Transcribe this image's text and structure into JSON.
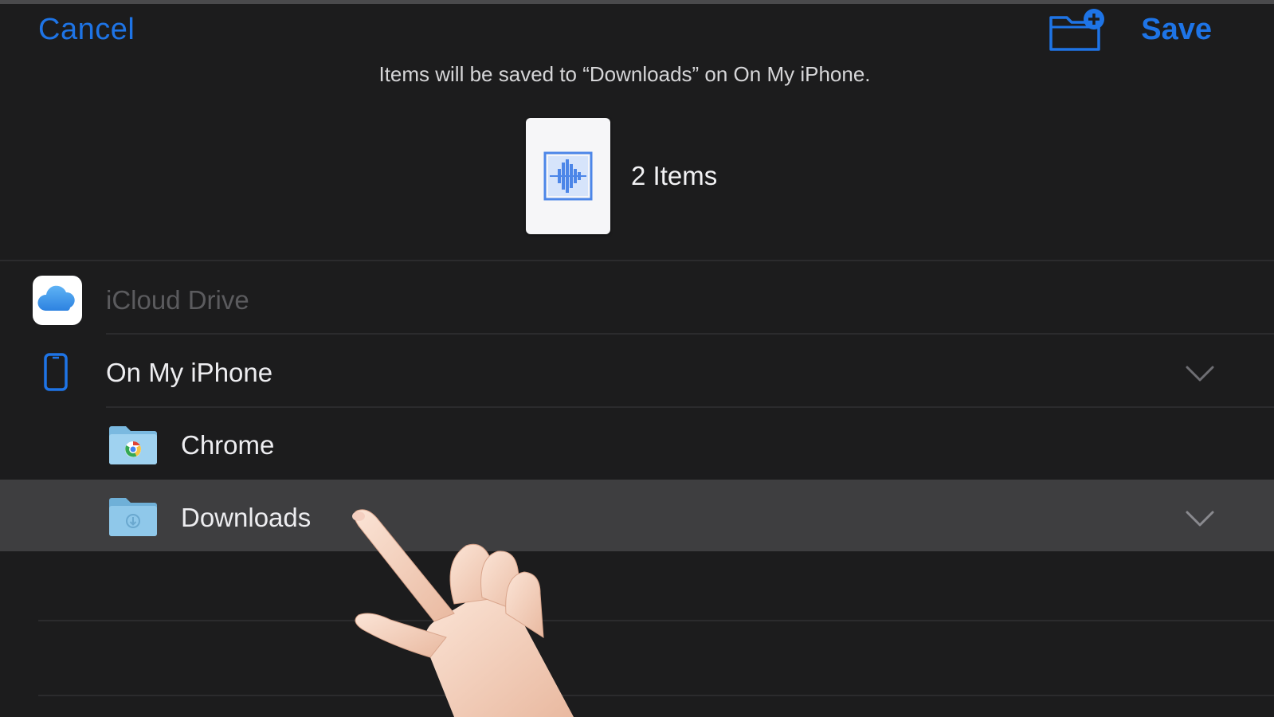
{
  "header": {
    "cancel_label": "Cancel",
    "save_label": "Save",
    "new_folder_icon": "folder-plus-icon",
    "accent_color": "#1e74e6"
  },
  "save_info": {
    "message": "Items will be saved to “Downloads” on On My iPhone.",
    "items_count": "2 Items",
    "thumbnail_icon": "audio-waveform-icon"
  },
  "locations": [
    {
      "label": "iCloud Drive",
      "icon": "icloud-icon",
      "enabled": false
    },
    {
      "label": "On My iPhone",
      "icon": "iphone-icon",
      "expanded": true,
      "children": [
        {
          "label": "Chrome",
          "icon": "chrome-folder-icon",
          "selected": false
        },
        {
          "label": "Downloads",
          "icon": "download-folder-icon",
          "selected": true
        }
      ]
    }
  ],
  "colors": {
    "background": "#1c1c1d",
    "selected_row": "#3e3e40",
    "folder": "#8fc8ea"
  }
}
